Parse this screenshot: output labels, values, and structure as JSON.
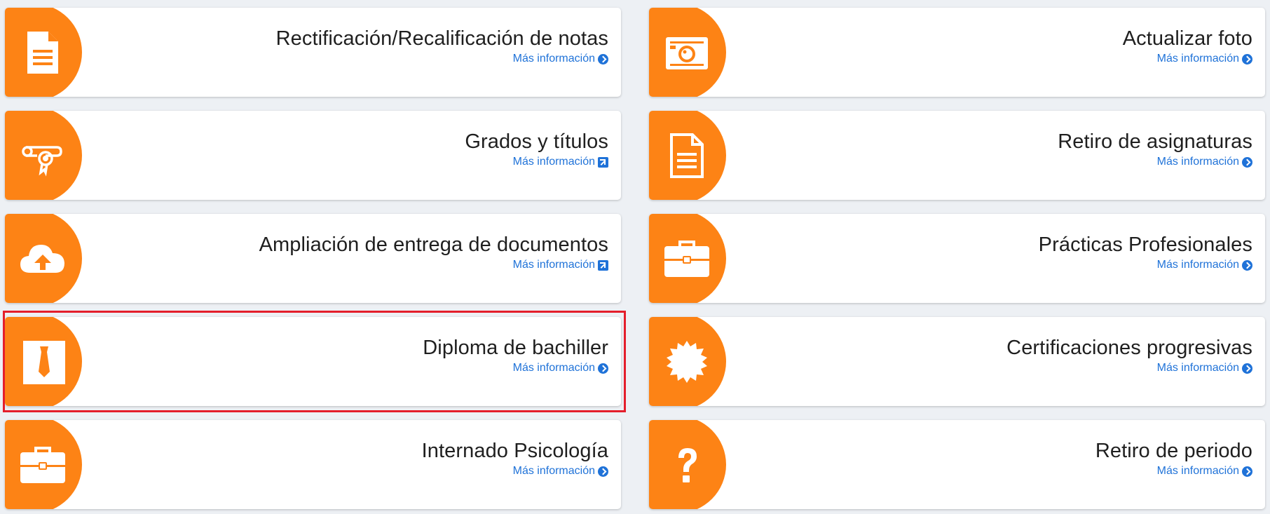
{
  "colors": {
    "accent": "#fd8315",
    "link": "#1f72d8",
    "highlight_border": "#e41e2b",
    "background": "#edf0f4"
  },
  "cards": [
    {
      "title": "Rectificación/Recalificación de notas",
      "link_label": "Más información",
      "link_icon": "arrow-circle-right-icon",
      "icon": "document-icon"
    },
    {
      "title": "Actualizar foto",
      "link_label": "Más información",
      "link_icon": "arrow-circle-right-icon",
      "icon": "camera-icon"
    },
    {
      "title": "Grados y títulos",
      "link_label": "Más información",
      "link_icon": "external-link-icon",
      "icon": "diploma-scroll-icon"
    },
    {
      "title": "Retiro de asignaturas",
      "link_label": "Más información",
      "link_icon": "arrow-circle-right-icon",
      "icon": "document-icon"
    },
    {
      "title": "Ampliación de entrega de documentos",
      "link_label": "Más información",
      "link_icon": "external-link-icon",
      "icon": "cloud-upload-icon"
    },
    {
      "title": "Prácticas Profesionales",
      "link_label": "Más información",
      "link_icon": "arrow-circle-right-icon",
      "icon": "briefcase-icon"
    },
    {
      "title": "Diploma de bachiller",
      "link_label": "Más información",
      "link_icon": "arrow-circle-right-icon",
      "icon": "tie-icon",
      "highlighted": true
    },
    {
      "title": "Certificaciones progresivas",
      "link_label": "Más información",
      "link_icon": "arrow-circle-right-icon",
      "icon": "certificate-badge-icon"
    },
    {
      "title": "Internado Psicología",
      "link_label": "Más información",
      "link_icon": "arrow-circle-right-icon",
      "icon": "briefcase-icon"
    },
    {
      "title": "Retiro de periodo",
      "link_label": "Más información",
      "link_icon": "arrow-circle-right-icon",
      "icon": "question-mark-icon"
    }
  ]
}
